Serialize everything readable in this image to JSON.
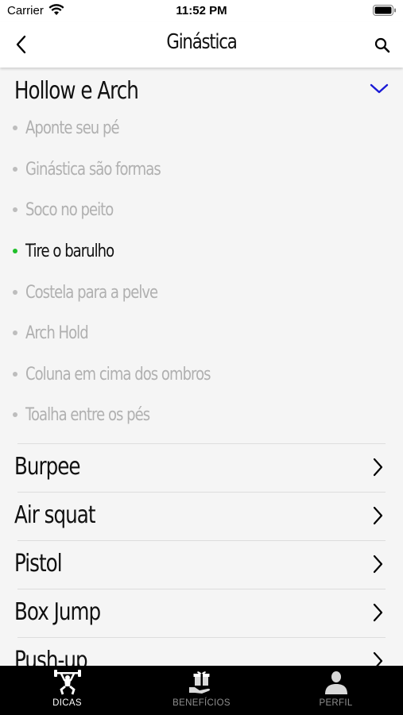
{
  "status_bar": {
    "carrier": "Carrier",
    "time": "11:52 PM"
  },
  "nav": {
    "title": "Ginástica",
    "back_icon": "chevron-left-icon",
    "search_icon": "search-icon"
  },
  "section": {
    "title": "Hollow e Arch",
    "expanded": true,
    "items": [
      {
        "label": "Aponte seu pé",
        "active": false
      },
      {
        "label": "Ginástica são formas",
        "active": false
      },
      {
        "label": "Soco no peito",
        "active": false
      },
      {
        "label": "Tire o barulho",
        "active": true
      },
      {
        "label": "Costela para a pelve",
        "active": false
      },
      {
        "label": "Arch Hold",
        "active": false
      },
      {
        "label": "Coluna em cima dos ombros",
        "active": false
      },
      {
        "label": "Toalha entre os pés",
        "active": false
      }
    ]
  },
  "rows": [
    {
      "title": "Burpee"
    },
    {
      "title": "Air squat"
    },
    {
      "title": "Pistol"
    },
    {
      "title": "Box Jump"
    },
    {
      "title": "Push-up"
    }
  ],
  "tabbar": {
    "tabs": [
      {
        "label": "DICAS",
        "icon": "weightlifter-icon",
        "active": true
      },
      {
        "label": "BENEFÍCIOS",
        "icon": "gift-hand-icon",
        "active": false
      },
      {
        "label": "PERFIL",
        "icon": "user-icon",
        "active": false
      }
    ]
  },
  "colors": {
    "accent": "#1a1ad6",
    "active_dot": "#1fbf2a",
    "inactive_text": "#b0b0b0"
  }
}
